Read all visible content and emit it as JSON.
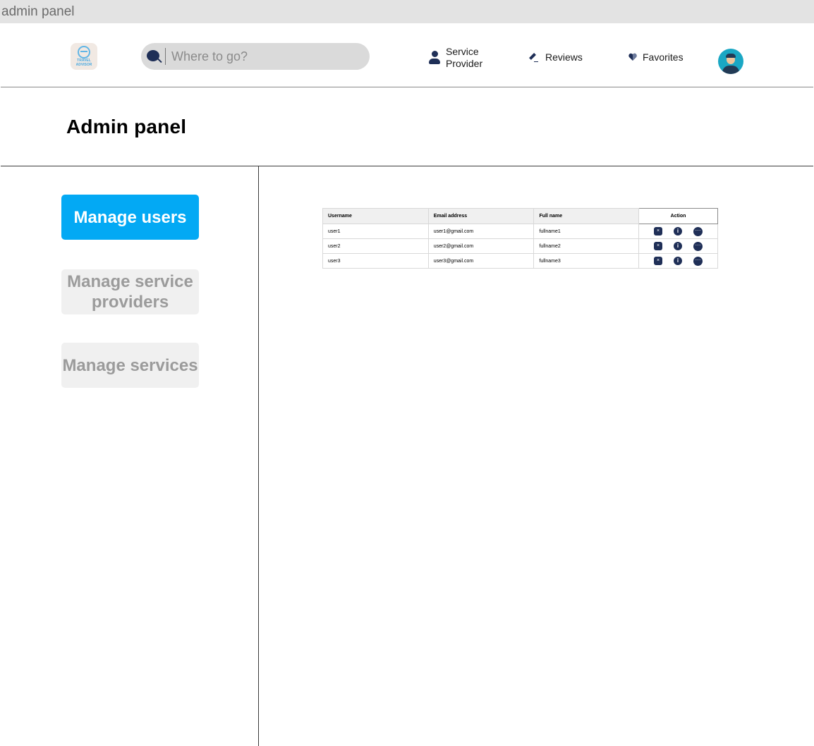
{
  "frame": {
    "label": "admin panel"
  },
  "header": {
    "logo": {
      "text_line1": "TRAVEL",
      "text_line2": "ADVISOR",
      "icon": "globe-icon"
    },
    "search": {
      "placeholder": "Where to go?",
      "value": "",
      "icon": "search-icon"
    },
    "nav": {
      "service_provider": {
        "line1": "Service",
        "line2": "Provider",
        "icon": "user-icon"
      },
      "reviews": {
        "label": "Reviews",
        "icon": "pencil-icon"
      },
      "favorites": {
        "label": "Favorites",
        "icon": "heart-icon"
      }
    },
    "avatar": {
      "icon": "avatar-icon"
    }
  },
  "page": {
    "title": "Admin panel"
  },
  "sidebar": {
    "items": [
      {
        "label": "Manage users",
        "active": true
      },
      {
        "label": "Manage service providers",
        "active": false
      },
      {
        "label": "Manage services",
        "active": false
      }
    ]
  },
  "colors": {
    "accent": "#03a9f4",
    "icon_dark": "#1f2f57",
    "inactive_bg": "#f0f0f0",
    "inactive_text": "#9b9b9b",
    "avatar_bg": "#1aa7c4"
  },
  "users_table": {
    "columns": [
      "Username",
      "Email address",
      "Full name",
      "Action"
    ],
    "rows": [
      {
        "username": "user1",
        "email": "user1@gmail.com",
        "full_name": "fullname1"
      },
      {
        "username": "user2",
        "email": "user2@gmail.com",
        "full_name": "fullname2"
      },
      {
        "username": "user3",
        "email": "user3@gmail.com",
        "full_name": "fullname3"
      }
    ],
    "action_icons": [
      "delete-icon",
      "info-icon",
      "more-icon"
    ],
    "action_glyphs": {
      "delete": "×",
      "info": "i",
      "more": "···"
    }
  }
}
